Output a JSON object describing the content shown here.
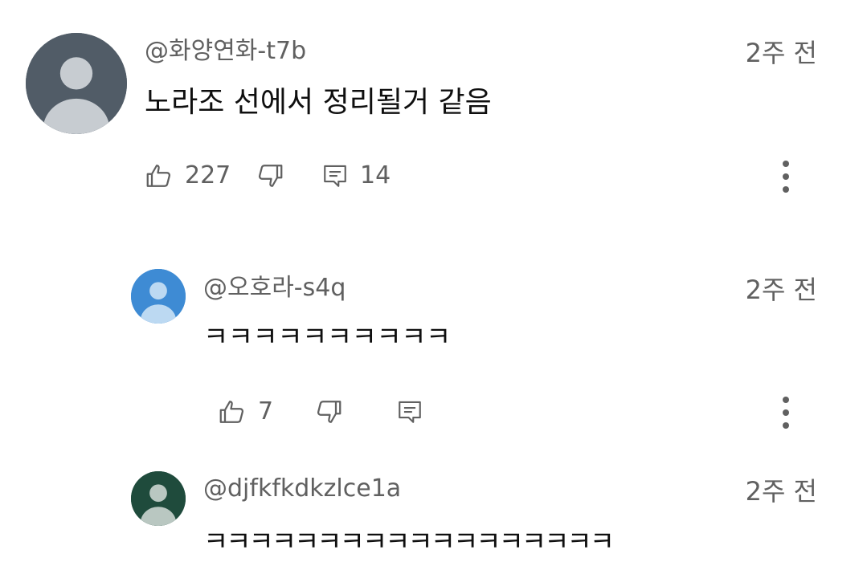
{
  "comments": [
    {
      "author": "@화양연화-t7b",
      "time": "2주 전",
      "text": "노라조 선에서 정리될거 같음",
      "likes": "227",
      "replies": "14",
      "avatar_bg": "#515c67",
      "avatar_fg": "#c7ccd1"
    },
    {
      "author": "@오호라-s4q",
      "time": "2주 전",
      "text": "ㅋㅋㅋㅋㅋㅋㅋㅋㅋㅋ",
      "likes": "7",
      "avatar_bg": "#3e8bd4",
      "avatar_fg": "#bcd9f2"
    },
    {
      "author": "@djfkfkdkzlce1a",
      "time": "2주 전",
      "text": "ㅋㅋㅋㅋㅋㅋㅋㅋㅋㅋㅋㅋㅋㅋㅋㅋㅋㅋ",
      "avatar_bg": "#1f4b3c",
      "avatar_fg": "#b9c7c1"
    }
  ],
  "icons": {
    "like": "thumb-up-icon",
    "dislike": "thumb-down-icon",
    "reply": "reply-icon",
    "more": "more-vertical-icon"
  }
}
